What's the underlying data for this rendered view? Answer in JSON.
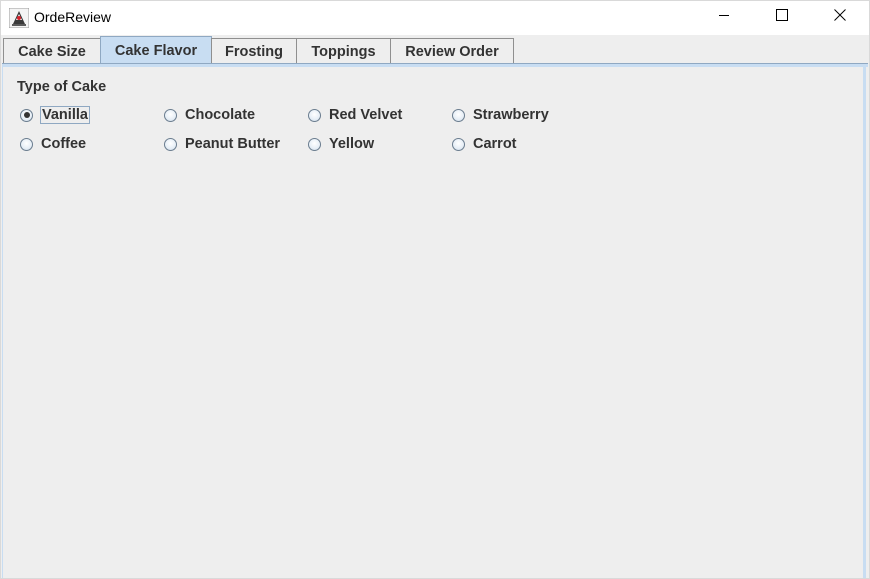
{
  "window": {
    "title": "OrdeReview"
  },
  "tabs": [
    {
      "label": "Cake Size",
      "selected": false
    },
    {
      "label": "Cake Flavor",
      "selected": true
    },
    {
      "label": "Frosting",
      "selected": false
    },
    {
      "label": "Toppings",
      "selected": false
    },
    {
      "label": "Review Order",
      "selected": false
    }
  ],
  "cake_flavor": {
    "group_title": "Type of Cake",
    "options": [
      {
        "label": "Vanilla",
        "checked": true
      },
      {
        "label": "Chocolate",
        "checked": false
      },
      {
        "label": "Red Velvet",
        "checked": false
      },
      {
        "label": "Strawberry",
        "checked": false
      },
      {
        "label": "Coffee",
        "checked": false
      },
      {
        "label": "Peanut Butter",
        "checked": false
      },
      {
        "label": "Yellow",
        "checked": false
      },
      {
        "label": "Carrot",
        "checked": false
      }
    ]
  },
  "colors": {
    "selected_tab": "#c8ddf2",
    "panel_bg": "#eeeeee",
    "text": "#333333"
  },
  "icons": {
    "app": "java-duke-icon",
    "minimize": "minimize-icon",
    "maximize": "maximize-icon",
    "close": "close-icon"
  }
}
